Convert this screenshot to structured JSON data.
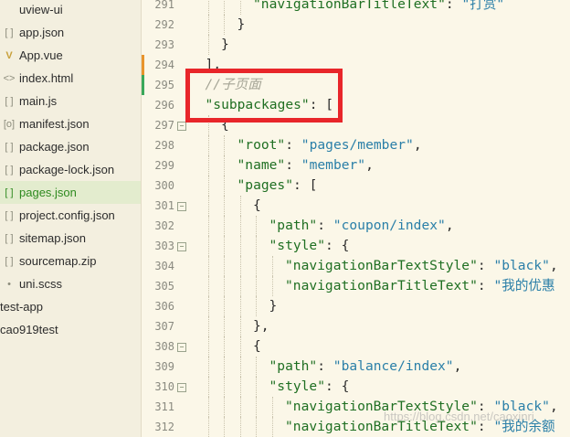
{
  "colors": {
    "background": "#fbf7e8",
    "sidebar_background": "#f3efdf",
    "selected_background": "#e3ecce",
    "json_key": "#1f6f22",
    "json_string": "#2a7fa8",
    "comment": "#a5a596",
    "highlight_box": "#e8262a",
    "change_bar_orange": "#e8942c",
    "change_bar_green": "#3aa85a"
  },
  "sidebar": {
    "items": [
      {
        "label": "uview-ui",
        "icon": "folder-icon",
        "kind": "folder",
        "selected": false
      },
      {
        "label": "app.json",
        "icon": "json-file-icon",
        "kind": "file",
        "selected": false
      },
      {
        "label": "App.vue",
        "icon": "vue-file-icon",
        "kind": "file",
        "selected": false
      },
      {
        "label": "index.html",
        "icon": "html-file-icon",
        "kind": "file",
        "selected": false
      },
      {
        "label": "main.js",
        "icon": "js-file-icon",
        "kind": "file",
        "selected": false
      },
      {
        "label": "manifest.json",
        "icon": "manifest-file-icon",
        "kind": "file",
        "selected": false
      },
      {
        "label": "package.json",
        "icon": "json-file-icon",
        "kind": "file",
        "selected": false
      },
      {
        "label": "package-lock.json",
        "icon": "json-file-icon",
        "kind": "file",
        "selected": false
      },
      {
        "label": "pages.json",
        "icon": "json-file-icon",
        "kind": "file",
        "selected": true
      },
      {
        "label": "project.config.json",
        "icon": "json-file-icon",
        "kind": "file",
        "selected": false
      },
      {
        "label": "sitemap.json",
        "icon": "json-file-icon",
        "kind": "file",
        "selected": false
      },
      {
        "label": "sourcemap.zip",
        "icon": "zip-file-icon",
        "kind": "file",
        "selected": false
      },
      {
        "label": "uni.scss",
        "icon": "scss-file-icon",
        "kind": "file",
        "selected": false
      },
      {
        "label": "test-app",
        "icon": "",
        "kind": "root",
        "selected": false
      },
      {
        "label": "cao919test",
        "icon": "",
        "kind": "root",
        "selected": false
      }
    ]
  },
  "editor": {
    "lines": [
      {
        "num": "291",
        "indent": 4,
        "fold": false,
        "change": "",
        "tokens": [
          {
            "t": "\"navigationBarTitleText\"",
            "c": "key"
          },
          {
            "t": ": ",
            "c": "punct"
          },
          {
            "t": "\"打赏\"",
            "c": "str"
          }
        ]
      },
      {
        "num": "292",
        "indent": 3,
        "fold": false,
        "change": "",
        "tokens": [
          {
            "t": "}",
            "c": "punct"
          }
        ]
      },
      {
        "num": "293",
        "indent": 2,
        "fold": false,
        "change": "",
        "tokens": [
          {
            "t": "}",
            "c": "punct"
          }
        ]
      },
      {
        "num": "294",
        "indent": 1,
        "fold": false,
        "change": "orange",
        "tokens": [
          {
            "t": "],",
            "c": "punct"
          }
        ]
      },
      {
        "num": "295",
        "indent": 1,
        "fold": false,
        "change": "green",
        "tokens": [
          {
            "t": "//子页面",
            "c": "comment"
          }
        ]
      },
      {
        "num": "296",
        "indent": 1,
        "fold": false,
        "change": "",
        "tokens": [
          {
            "t": "\"subpackages\"",
            "c": "key"
          },
          {
            "t": ": [",
            "c": "punct"
          }
        ]
      },
      {
        "num": "297",
        "indent": 2,
        "fold": true,
        "change": "",
        "tokens": [
          {
            "t": "{",
            "c": "punct"
          }
        ]
      },
      {
        "num": "298",
        "indent": 3,
        "fold": false,
        "change": "",
        "tokens": [
          {
            "t": "\"root\"",
            "c": "key"
          },
          {
            "t": ": ",
            "c": "punct"
          },
          {
            "t": "\"pages/member\"",
            "c": "str"
          },
          {
            "t": ",",
            "c": "punct"
          }
        ]
      },
      {
        "num": "299",
        "indent": 3,
        "fold": false,
        "change": "",
        "tokens": [
          {
            "t": "\"name\"",
            "c": "key"
          },
          {
            "t": ": ",
            "c": "punct"
          },
          {
            "t": "\"member\"",
            "c": "str"
          },
          {
            "t": ",",
            "c": "punct"
          }
        ]
      },
      {
        "num": "300",
        "indent": 3,
        "fold": false,
        "change": "",
        "tokens": [
          {
            "t": "\"pages\"",
            "c": "key"
          },
          {
            "t": ": [",
            "c": "punct"
          }
        ]
      },
      {
        "num": "301",
        "indent": 4,
        "fold": true,
        "change": "",
        "tokens": [
          {
            "t": "{",
            "c": "punct"
          }
        ]
      },
      {
        "num": "302",
        "indent": 5,
        "fold": false,
        "change": "",
        "tokens": [
          {
            "t": "\"path\"",
            "c": "key"
          },
          {
            "t": ": ",
            "c": "punct"
          },
          {
            "t": "\"coupon/index\"",
            "c": "str"
          },
          {
            "t": ",",
            "c": "punct"
          }
        ]
      },
      {
        "num": "303",
        "indent": 5,
        "fold": true,
        "change": "",
        "tokens": [
          {
            "t": "\"style\"",
            "c": "key"
          },
          {
            "t": ": {",
            "c": "punct"
          }
        ]
      },
      {
        "num": "304",
        "indent": 6,
        "fold": false,
        "change": "",
        "tokens": [
          {
            "t": "\"navigationBarTextStyle\"",
            "c": "key"
          },
          {
            "t": ": ",
            "c": "punct"
          },
          {
            "t": "\"black\"",
            "c": "str"
          },
          {
            "t": ",",
            "c": "punct"
          }
        ]
      },
      {
        "num": "305",
        "indent": 6,
        "fold": false,
        "change": "",
        "tokens": [
          {
            "t": "\"navigationBarTitleText\"",
            "c": "key"
          },
          {
            "t": ": ",
            "c": "punct"
          },
          {
            "t": "\"我的优惠",
            "c": "str"
          }
        ]
      },
      {
        "num": "306",
        "indent": 5,
        "fold": false,
        "change": "",
        "tokens": [
          {
            "t": "}",
            "c": "punct"
          }
        ]
      },
      {
        "num": "307",
        "indent": 4,
        "fold": false,
        "change": "",
        "tokens": [
          {
            "t": "},",
            "c": "punct"
          }
        ]
      },
      {
        "num": "308",
        "indent": 4,
        "fold": true,
        "change": "",
        "tokens": [
          {
            "t": "{",
            "c": "punct"
          }
        ]
      },
      {
        "num": "309",
        "indent": 5,
        "fold": false,
        "change": "",
        "tokens": [
          {
            "t": "\"path\"",
            "c": "key"
          },
          {
            "t": ": ",
            "c": "punct"
          },
          {
            "t": "\"balance/index\"",
            "c": "str"
          },
          {
            "t": ",",
            "c": "punct"
          }
        ]
      },
      {
        "num": "310",
        "indent": 5,
        "fold": true,
        "change": "",
        "tokens": [
          {
            "t": "\"style\"",
            "c": "key"
          },
          {
            "t": ": {",
            "c": "punct"
          }
        ]
      },
      {
        "num": "311",
        "indent": 6,
        "fold": false,
        "change": "",
        "tokens": [
          {
            "t": "\"navigationBarTextStyle\"",
            "c": "key"
          },
          {
            "t": ": ",
            "c": "punct"
          },
          {
            "t": "\"black\"",
            "c": "str"
          },
          {
            "t": ",",
            "c": "punct"
          }
        ]
      },
      {
        "num": "312",
        "indent": 6,
        "fold": false,
        "change": "",
        "tokens": [
          {
            "t": "\"navigationBarTitleText\"",
            "c": "key"
          },
          {
            "t": ": ",
            "c": "punct"
          },
          {
            "t": "\"我的余额",
            "c": "str"
          }
        ]
      }
    ]
  },
  "watermark": "https://blog.csdn.net/caoxinri"
}
